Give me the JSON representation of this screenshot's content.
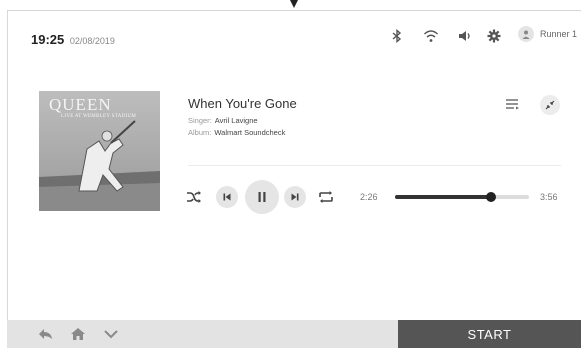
{
  "header": {
    "time": "19:25",
    "date": "02/08/2019",
    "user_name": "Runner 1",
    "status_icons": [
      "bluetooth-icon",
      "wifi-icon",
      "volume-icon",
      "settings-gear-icon",
      "user-icon"
    ]
  },
  "album_art": {
    "brand_text": "QUEEN",
    "subtitle_text": "LIVE AT WEMBLEY STADIUM"
  },
  "track": {
    "title": "When You're Gone",
    "singer_label": "Singer:",
    "singer": "Avril Lavigne",
    "album_label": "Album:",
    "album": "Walmart Soundcheck"
  },
  "player": {
    "current_time": "2:26",
    "total_time": "3:56",
    "progress_fraction": 0.72,
    "controls": [
      "shuffle-icon",
      "previous-icon",
      "pause-icon",
      "next-icon",
      "repeat-icon"
    ]
  },
  "bottom_bar": {
    "nav_icons": [
      "back-icon",
      "home-icon",
      "chevron-down-icon"
    ],
    "start_label": "START"
  }
}
